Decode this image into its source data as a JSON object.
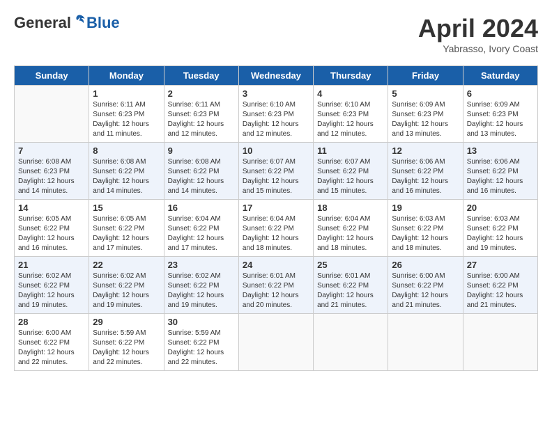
{
  "header": {
    "logo_general": "General",
    "logo_blue": "Blue",
    "month_title": "April 2024",
    "subtitle": "Yabrasso, Ivory Coast"
  },
  "days_of_week": [
    "Sunday",
    "Monday",
    "Tuesday",
    "Wednesday",
    "Thursday",
    "Friday",
    "Saturday"
  ],
  "weeks": [
    [
      {
        "day": "",
        "info": ""
      },
      {
        "day": "1",
        "info": "Sunrise: 6:11 AM\nSunset: 6:23 PM\nDaylight: 12 hours and 11 minutes."
      },
      {
        "day": "2",
        "info": "Sunrise: 6:11 AM\nSunset: 6:23 PM\nDaylight: 12 hours and 12 minutes."
      },
      {
        "day": "3",
        "info": "Sunrise: 6:10 AM\nSunset: 6:23 PM\nDaylight: 12 hours and 12 minutes."
      },
      {
        "day": "4",
        "info": "Sunrise: 6:10 AM\nSunset: 6:23 PM\nDaylight: 12 hours and 12 minutes."
      },
      {
        "day": "5",
        "info": "Sunrise: 6:09 AM\nSunset: 6:23 PM\nDaylight: 12 hours and 13 minutes."
      },
      {
        "day": "6",
        "info": "Sunrise: 6:09 AM\nSunset: 6:23 PM\nDaylight: 12 hours and 13 minutes."
      }
    ],
    [
      {
        "day": "7",
        "info": "Sunrise: 6:08 AM\nSunset: 6:23 PM\nDaylight: 12 hours and 14 minutes."
      },
      {
        "day": "8",
        "info": "Sunrise: 6:08 AM\nSunset: 6:22 PM\nDaylight: 12 hours and 14 minutes."
      },
      {
        "day": "9",
        "info": "Sunrise: 6:08 AM\nSunset: 6:22 PM\nDaylight: 12 hours and 14 minutes."
      },
      {
        "day": "10",
        "info": "Sunrise: 6:07 AM\nSunset: 6:22 PM\nDaylight: 12 hours and 15 minutes."
      },
      {
        "day": "11",
        "info": "Sunrise: 6:07 AM\nSunset: 6:22 PM\nDaylight: 12 hours and 15 minutes."
      },
      {
        "day": "12",
        "info": "Sunrise: 6:06 AM\nSunset: 6:22 PM\nDaylight: 12 hours and 16 minutes."
      },
      {
        "day": "13",
        "info": "Sunrise: 6:06 AM\nSunset: 6:22 PM\nDaylight: 12 hours and 16 minutes."
      }
    ],
    [
      {
        "day": "14",
        "info": "Sunrise: 6:05 AM\nSunset: 6:22 PM\nDaylight: 12 hours and 16 minutes."
      },
      {
        "day": "15",
        "info": "Sunrise: 6:05 AM\nSunset: 6:22 PM\nDaylight: 12 hours and 17 minutes."
      },
      {
        "day": "16",
        "info": "Sunrise: 6:04 AM\nSunset: 6:22 PM\nDaylight: 12 hours and 17 minutes."
      },
      {
        "day": "17",
        "info": "Sunrise: 6:04 AM\nSunset: 6:22 PM\nDaylight: 12 hours and 18 minutes."
      },
      {
        "day": "18",
        "info": "Sunrise: 6:04 AM\nSunset: 6:22 PM\nDaylight: 12 hours and 18 minutes."
      },
      {
        "day": "19",
        "info": "Sunrise: 6:03 AM\nSunset: 6:22 PM\nDaylight: 12 hours and 18 minutes."
      },
      {
        "day": "20",
        "info": "Sunrise: 6:03 AM\nSunset: 6:22 PM\nDaylight: 12 hours and 19 minutes."
      }
    ],
    [
      {
        "day": "21",
        "info": "Sunrise: 6:02 AM\nSunset: 6:22 PM\nDaylight: 12 hours and 19 minutes."
      },
      {
        "day": "22",
        "info": "Sunrise: 6:02 AM\nSunset: 6:22 PM\nDaylight: 12 hours and 19 minutes."
      },
      {
        "day": "23",
        "info": "Sunrise: 6:02 AM\nSunset: 6:22 PM\nDaylight: 12 hours and 19 minutes."
      },
      {
        "day": "24",
        "info": "Sunrise: 6:01 AM\nSunset: 6:22 PM\nDaylight: 12 hours and 20 minutes."
      },
      {
        "day": "25",
        "info": "Sunrise: 6:01 AM\nSunset: 6:22 PM\nDaylight: 12 hours and 21 minutes."
      },
      {
        "day": "26",
        "info": "Sunrise: 6:00 AM\nSunset: 6:22 PM\nDaylight: 12 hours and 21 minutes."
      },
      {
        "day": "27",
        "info": "Sunrise: 6:00 AM\nSunset: 6:22 PM\nDaylight: 12 hours and 21 minutes."
      }
    ],
    [
      {
        "day": "28",
        "info": "Sunrise: 6:00 AM\nSunset: 6:22 PM\nDaylight: 12 hours and 22 minutes."
      },
      {
        "day": "29",
        "info": "Sunrise: 5:59 AM\nSunset: 6:22 PM\nDaylight: 12 hours and 22 minutes."
      },
      {
        "day": "30",
        "info": "Sunrise: 5:59 AM\nSunset: 6:22 PM\nDaylight: 12 hours and 22 minutes."
      },
      {
        "day": "",
        "info": ""
      },
      {
        "day": "",
        "info": ""
      },
      {
        "day": "",
        "info": ""
      },
      {
        "day": "",
        "info": ""
      }
    ]
  ]
}
